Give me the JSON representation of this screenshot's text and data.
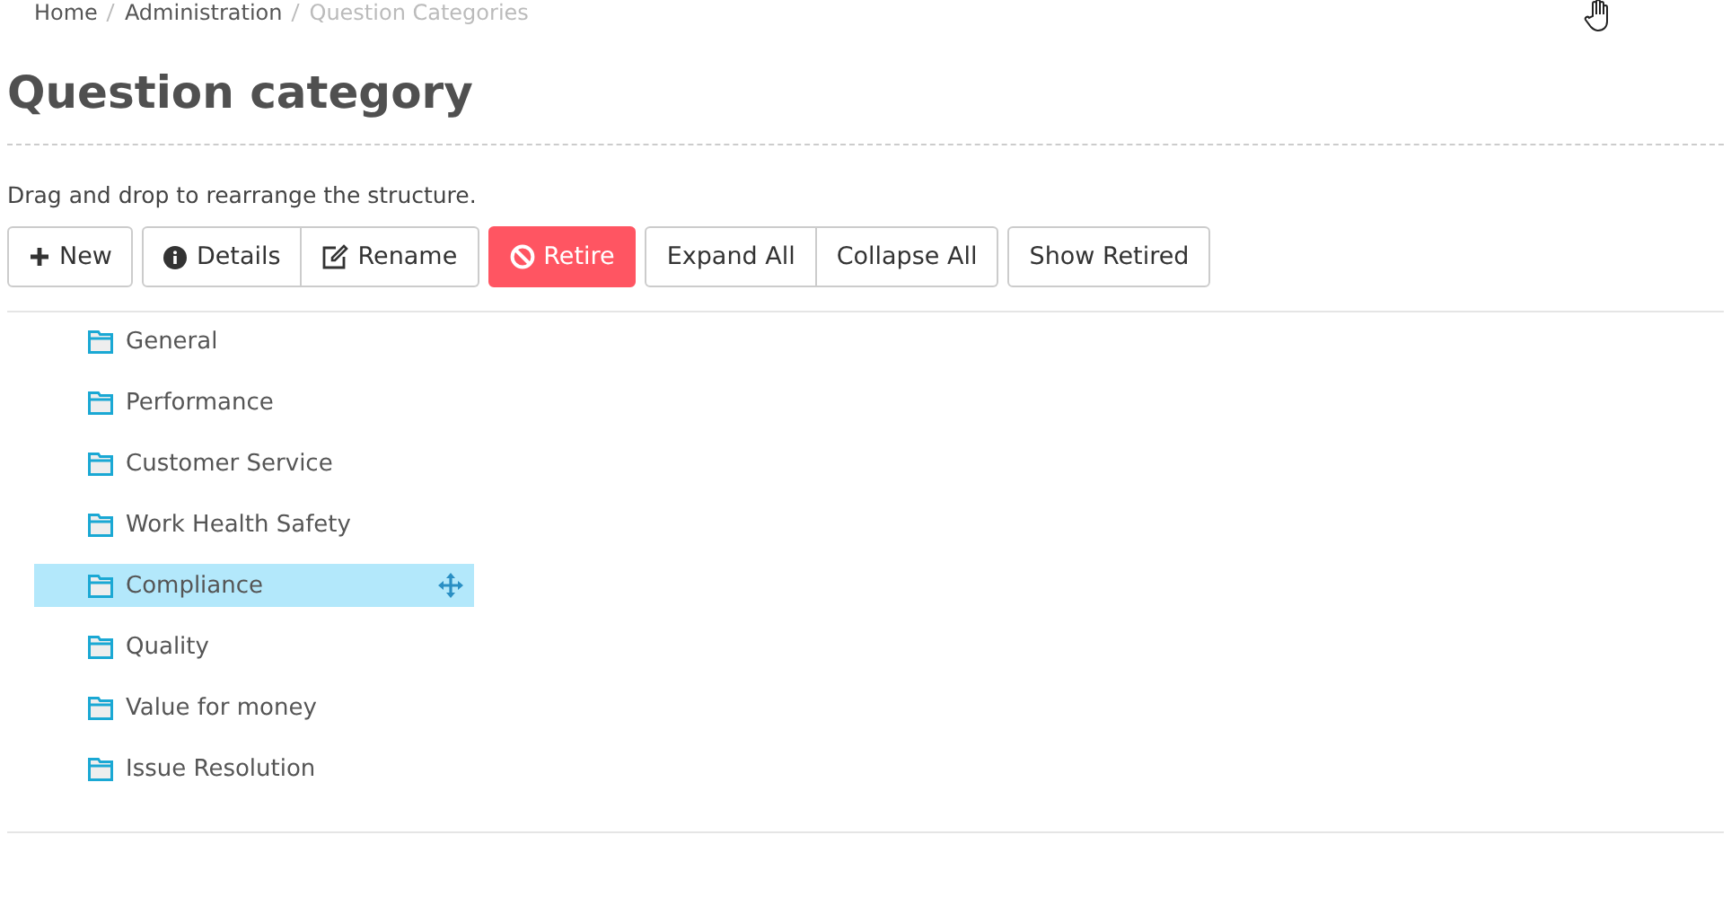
{
  "breadcrumb": [
    {
      "label": "Home",
      "current": false
    },
    {
      "label": "Administration",
      "current": false
    },
    {
      "label": "Question Categories",
      "current": true
    }
  ],
  "title": "Question category",
  "hint": "Drag and drop to rearrange the structure.",
  "toolbar": [
    [
      {
        "label": "New",
        "kind": "add"
      }
    ],
    [
      {
        "label": "Details",
        "kind": "info"
      },
      {
        "label": "Rename",
        "kind": "edit"
      }
    ],
    [
      {
        "label": "Retire",
        "kind": "danger"
      }
    ],
    [
      {
        "label": "Expand All",
        "kind": "plain"
      },
      {
        "label": "Collapse All",
        "kind": "plain"
      }
    ],
    [
      {
        "label": "Show Retired",
        "kind": "plain"
      }
    ]
  ],
  "tree": [
    {
      "label": "General",
      "selected": false
    },
    {
      "label": "Performance",
      "selected": false
    },
    {
      "label": "Customer Service",
      "selected": false
    },
    {
      "label": "Work Health Safety",
      "selected": false
    },
    {
      "label": "Compliance",
      "selected": true
    },
    {
      "label": "Quality",
      "selected": false
    },
    {
      "label": "Value for money",
      "selected": false
    },
    {
      "label": "Issue Resolution",
      "selected": false
    }
  ]
}
